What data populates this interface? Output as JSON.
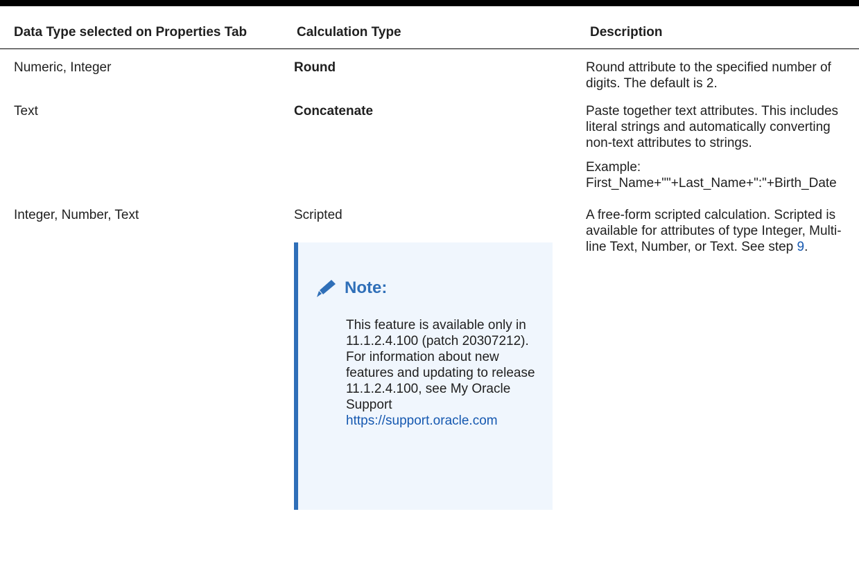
{
  "table": {
    "headers": [
      "Data Type selected on Properties Tab",
      "Calculation Type",
      "Description"
    ],
    "rows": [
      {
        "data_type": "Numeric, Integer",
        "calc_type": "Round",
        "description": [
          "Round attribute to the specified number of digits. The default is 2."
        ]
      },
      {
        "data_type": "Text",
        "calc_type": "Concatenate",
        "description": [
          "Paste together text attributes. This includes literal strings and automatically converting non-text attributes to strings.",
          "Example: First_Name+\"\"+Last_Name+\":\"+Birth_Date"
        ]
      },
      {
        "data_type": "Integer, Number, Text",
        "calc_type": "Scripted",
        "description_text": "A free-form scripted calculation. Scripted is available for attributes of type Integer, Multi-line Text, Number, or Text. See step ",
        "description_link": "9",
        "description_end": "."
      }
    ]
  },
  "note": {
    "icon": "pencil-icon",
    "title": "Note:",
    "body": "This feature is available only in 11.1.2.4.100 (patch 20307212). For information about new features and updating to release 11.1.2.4.100, see My Oracle Support ",
    "link": "https://support.oracle.com"
  },
  "colors": {
    "accent": "#2f6fb8",
    "note_bg": "#f0f6fd",
    "link": "#1558b0"
  }
}
